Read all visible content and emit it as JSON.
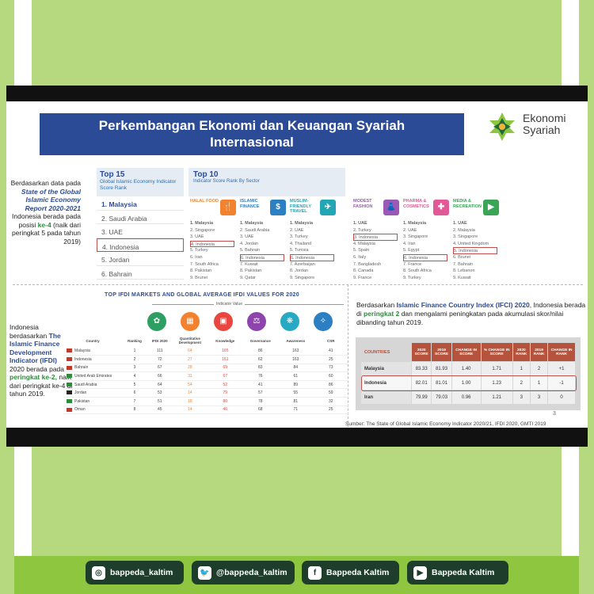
{
  "slide": {
    "title_line1": "Perkembangan Ekonomi dan Keuangan Syariah",
    "title_line2": "Internasional",
    "logo_line1": "Ekonomi",
    "logo_line2": "Syariah",
    "page_number": "3",
    "source": "Sumber: The State of Global Islamic Economy Indicator 2020/21, IFDI 2020, GMTI 2019"
  },
  "note_gie": {
    "p1": "Berdasarkan data pada ",
    "report": "State of the Global Islamic Economy Report 2020-2021",
    "p2": " Indonesia berada pada posisi ",
    "rank": "ke-4",
    "p3": " (naik dari peringkat 5 pada tahun 2019)"
  },
  "top15": {
    "title": "Top 15",
    "subtitle": "Global Islamic Economy Indicator Score Rank",
    "rows": [
      "1.  Malaysia",
      "2.  Saudi Arabia",
      "3.  UAE",
      "4.  Indonesia",
      "5.  Jordan",
      "6.  Bahrain"
    ]
  },
  "top10": {
    "title": "Top 10",
    "subtitle": "Indicator Score Rank By Sector",
    "sectors": [
      {
        "name": "HALAL FOOD",
        "color": "#f2822e",
        "icon": "🍴",
        "items": [
          "1. Malaysia",
          "2. Singapore",
          "3. UAE",
          "4. Indonesia",
          "5. Turkey",
          "6. Iran",
          "7. South Africa",
          "8. Pakistan",
          "9. Brunei"
        ]
      },
      {
        "name": "ISLAMIC FINANCE",
        "color": "#2c7fc2",
        "icon": "$",
        "items": [
          "1. Malaysia",
          "2. Saudi Arabia",
          "3. UAE",
          "4. Jordan",
          "5. Bahrain",
          "6. Indonesia",
          "7. Kuwait",
          "8. Pakistan",
          "9. Qatar"
        ]
      },
      {
        "name": "MUSLIM-FRIENDLY TRAVEL",
        "color": "#22a6b3",
        "icon": "✈",
        "items": [
          "1. Malaysia",
          "2. UAE",
          "3. Turkey",
          "4. Thailand",
          "5. Tunisia",
          "6. Indonesia",
          "7. Azerbaijan",
          "8. Jordan",
          "9. Singapore"
        ]
      },
      {
        "name": "MODEST FASHION",
        "color": "#9b59b6",
        "icon": "👗",
        "items": [
          "1. UAE",
          "2. Turkey",
          "3. Indonesia",
          "4. Malaysia",
          "5. Spain",
          "6. Italy",
          "7. Bangladesh",
          "8. Canada",
          "9. France"
        ]
      },
      {
        "name": "PHARMA & COSMETICS",
        "color": "#e15a97",
        "icon": "✚",
        "items": [
          "1. Malaysia",
          "2. UAE",
          "3. Singapore",
          "4. Iran",
          "5. Egypt",
          "6. Indonesia",
          "7. France",
          "8. South Africa",
          "9. Turkey"
        ]
      },
      {
        "name": "MEDIA & RECREATION",
        "color": "#3aa557",
        "icon": "▶",
        "items": [
          "1. UAE",
          "2. Malaysia",
          "3. Singapore",
          "4. United Kingdom",
          "5. Indonesia",
          "6. Brunei",
          "7. Bahrain",
          "8. Lebanon",
          "9. Kuwait"
        ]
      }
    ]
  },
  "note_ifdi": {
    "p1": "Indonesia berdasarkan ",
    "name": "The Islamic Finance Development Indicator (IFDI)",
    "p2": " 2020 berada pada ",
    "rank": "peringkat ke-2,",
    "p3": " naik dari peringkat ke-4 di tahun 2019."
  },
  "ifdi": {
    "title": "TOP IFDI MARKETS AND GLOBAL AVERAGE IFDI VALUES FOR 2020",
    "indicator_label": "Indicator Value",
    "columns": [
      "Country",
      "Ranking",
      "IFDI 2020",
      "Quantitative Development",
      "Knowledge",
      "Governance",
      "Awareness",
      "CSR"
    ],
    "icon_colors": [
      "#2e9f62",
      "#f2822e",
      "#e8463f",
      "#8e44ad",
      "#27a9c4",
      "#2c7fc2"
    ],
    "icons": [
      "✿",
      "▦",
      "▣",
      "⚖",
      "❋",
      "✧"
    ],
    "rows": [
      [
        "Malaysia",
        "1",
        "111",
        "64",
        "165",
        "86",
        "163",
        "41"
      ],
      [
        "Indonesia",
        "2",
        "72",
        "27",
        "161",
        "62",
        "163",
        "25"
      ],
      [
        "Bahrain",
        "3",
        "67",
        "28",
        "69",
        "83",
        "84",
        "73"
      ],
      [
        "United Arab Emirates",
        "4",
        "66",
        "31",
        "67",
        "76",
        "61",
        "60"
      ],
      [
        "Saudi Arabia",
        "5",
        "64",
        "54",
        "52",
        "41",
        "89",
        "86"
      ],
      [
        "Jordan",
        "6",
        "53",
        "14",
        "79",
        "57",
        "55",
        "59"
      ],
      [
        "Pakistan",
        "7",
        "51",
        "18",
        "80",
        "78",
        "81",
        "32"
      ],
      [
        "Oman",
        "8",
        "45",
        "14",
        "46",
        "68",
        "71",
        "25"
      ]
    ]
  },
  "note_ifci": {
    "p1": "Berdasarkan ",
    "name": "Islamic Finance Country Index (IFCI) 2020",
    "p2": ", Indonesia berada di ",
    "rank": "peringkat 2",
    "p3": " dan mengalami peningkatan pada akumulasi skor/nilai dibanding tahun 2019."
  },
  "ifci": {
    "headers": [
      "COUNTRIES",
      "2020 SCORE",
      "2019 SCORE",
      "CHANGE IN SCORE",
      "% CHANGE IN SCORE",
      "2020 RANK",
      "2019 RANK",
      "CHANGE IN RANK"
    ],
    "rows": [
      [
        "Malaysia",
        "83.33",
        "81.93",
        "1.40",
        "1.71",
        "1",
        "2",
        "+1"
      ],
      [
        "Indonesia",
        "82.01",
        "81.01",
        "1.00",
        "1.23",
        "2",
        "1",
        "-1"
      ],
      [
        "Iran",
        "79.99",
        "79.03",
        "0.96",
        "1.21",
        "3",
        "3",
        "0"
      ]
    ]
  },
  "social": [
    {
      "icon": "instagram-icon",
      "glyph": "◎",
      "label": "bappeda_kaltim"
    },
    {
      "icon": "twitter-icon",
      "glyph": "🐦",
      "label": "@bappeda_kaltim"
    },
    {
      "icon": "facebook-icon",
      "glyph": "f",
      "label": "Bappeda Kaltim"
    },
    {
      "icon": "youtube-icon",
      "glyph": "▶",
      "label": "Bappeda Kaltim"
    }
  ]
}
